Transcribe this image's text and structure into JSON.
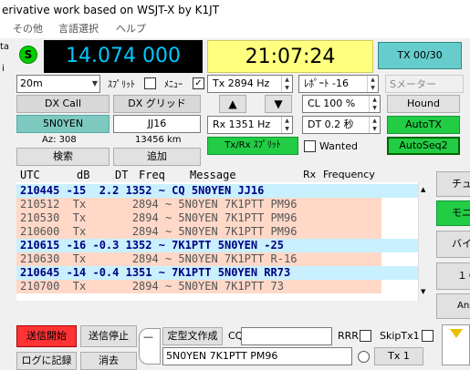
{
  "window": {
    "title": "erivative work based on WSJT-X by K1JT"
  },
  "menu": [
    "その他",
    "言語選択",
    "ヘルプ"
  ],
  "left_edge": {
    "top_char": "ta",
    "mid_char": "i"
  },
  "status": {
    "s_badge": "S",
    "frequency": "14.074 000",
    "clock": "21:07:24",
    "tx_button": "TX 00/30"
  },
  "controls": {
    "band": "20m",
    "split_label": "ｽﾌﾟﾘｯﾄ",
    "menu_label": "ﾒﾆｭｰ",
    "menu_checked": true,
    "split_checked": false,
    "tx_freq": "Tx  2894  Hz",
    "report": "ﾚﾎﾟｰﾄ -16",
    "smeter": "Sメーター",
    "up_arrow": "▲",
    "down_arrow": "▼",
    "cl": "CL  100 %",
    "hound": "Hound",
    "rx_freq": "Rx  1351  Hz",
    "dt": "DT 0.2 秒",
    "autotx": "AutoTX",
    "txrx_split": "Tx/Rx ｽﾌﾟﾘｯﾄ",
    "wanted": "Wanted",
    "autoseq": "AutoSeq2"
  },
  "dx": {
    "call_label": "DX Call",
    "grid_label": "DX グリッド",
    "call": "5N0YEN",
    "grid": "JJ16",
    "az": "Az: 308",
    "dist": "13456 km",
    "search": "検索",
    "add": "追加"
  },
  "decode": {
    "header": [
      "UTC",
      "dB",
      "DT",
      "Freq",
      "Message"
    ],
    "rx_label": "Rx",
    "freq_label": "Frequency",
    "rows": [
      {
        "text": "210445 -15  2.2 1352 ~ CQ 5N0YEN JJ16",
        "kind": "rx",
        "bg": "#c8f0ff"
      },
      {
        "text": "210512  Tx       2894 ~ 5N0YEN 7K1PTT PM96",
        "kind": "tx",
        "bg": "#ffd8c8"
      },
      {
        "text": "210530  Tx       2894 ~ 5N0YEN 7K1PTT PM96",
        "kind": "tx",
        "bg": "#ffd8c8"
      },
      {
        "text": "210600  Tx       2894 ~ 5N0YEN 7K1PTT PM96",
        "kind": "tx",
        "bg": "#ffd8c8"
      },
      {
        "text": "210615 -16 -0.3 1352 ~ 7K1PTT 5N0YEN -25",
        "kind": "rx",
        "bg": "#c8f0ff"
      },
      {
        "text": "210630  Tx       2894 ~ 5N0YEN 7K1PTT R-16",
        "kind": "tx",
        "bg": "#ffd8c8"
      },
      {
        "text": "210645 -14 -0.4 1351 ~ 7K1PTT 5N0YEN RR73",
        "kind": "rx",
        "bg": "#c8f0ff"
      },
      {
        "text": "210700  Tx       2894 ~ 5N0YEN 7K1PTT 73",
        "kind": "tx",
        "bg": "#ffd8c8"
      }
    ]
  },
  "right_buttons": [
    "チュ",
    "モニ",
    "バイ",
    "１０",
    "Ans"
  ],
  "bottom": {
    "tx_enable": "送信開始",
    "tx_stop": "送信停止",
    "preset": "定型文作成",
    "cq_label": "CQ",
    "rrr": "RRR",
    "skiptx1": "SkipTx1",
    "message": "5N0YEN 7K1PTT PM96",
    "tx1": "Tx 1",
    "log": "ログに記録",
    "clear": "消去",
    "dash": "—"
  },
  "colors": {
    "green": "#00cc00",
    "red": "#ff3333",
    "clock_bg": "#ffff80",
    "txbtn_bg": "#66cccc"
  }
}
